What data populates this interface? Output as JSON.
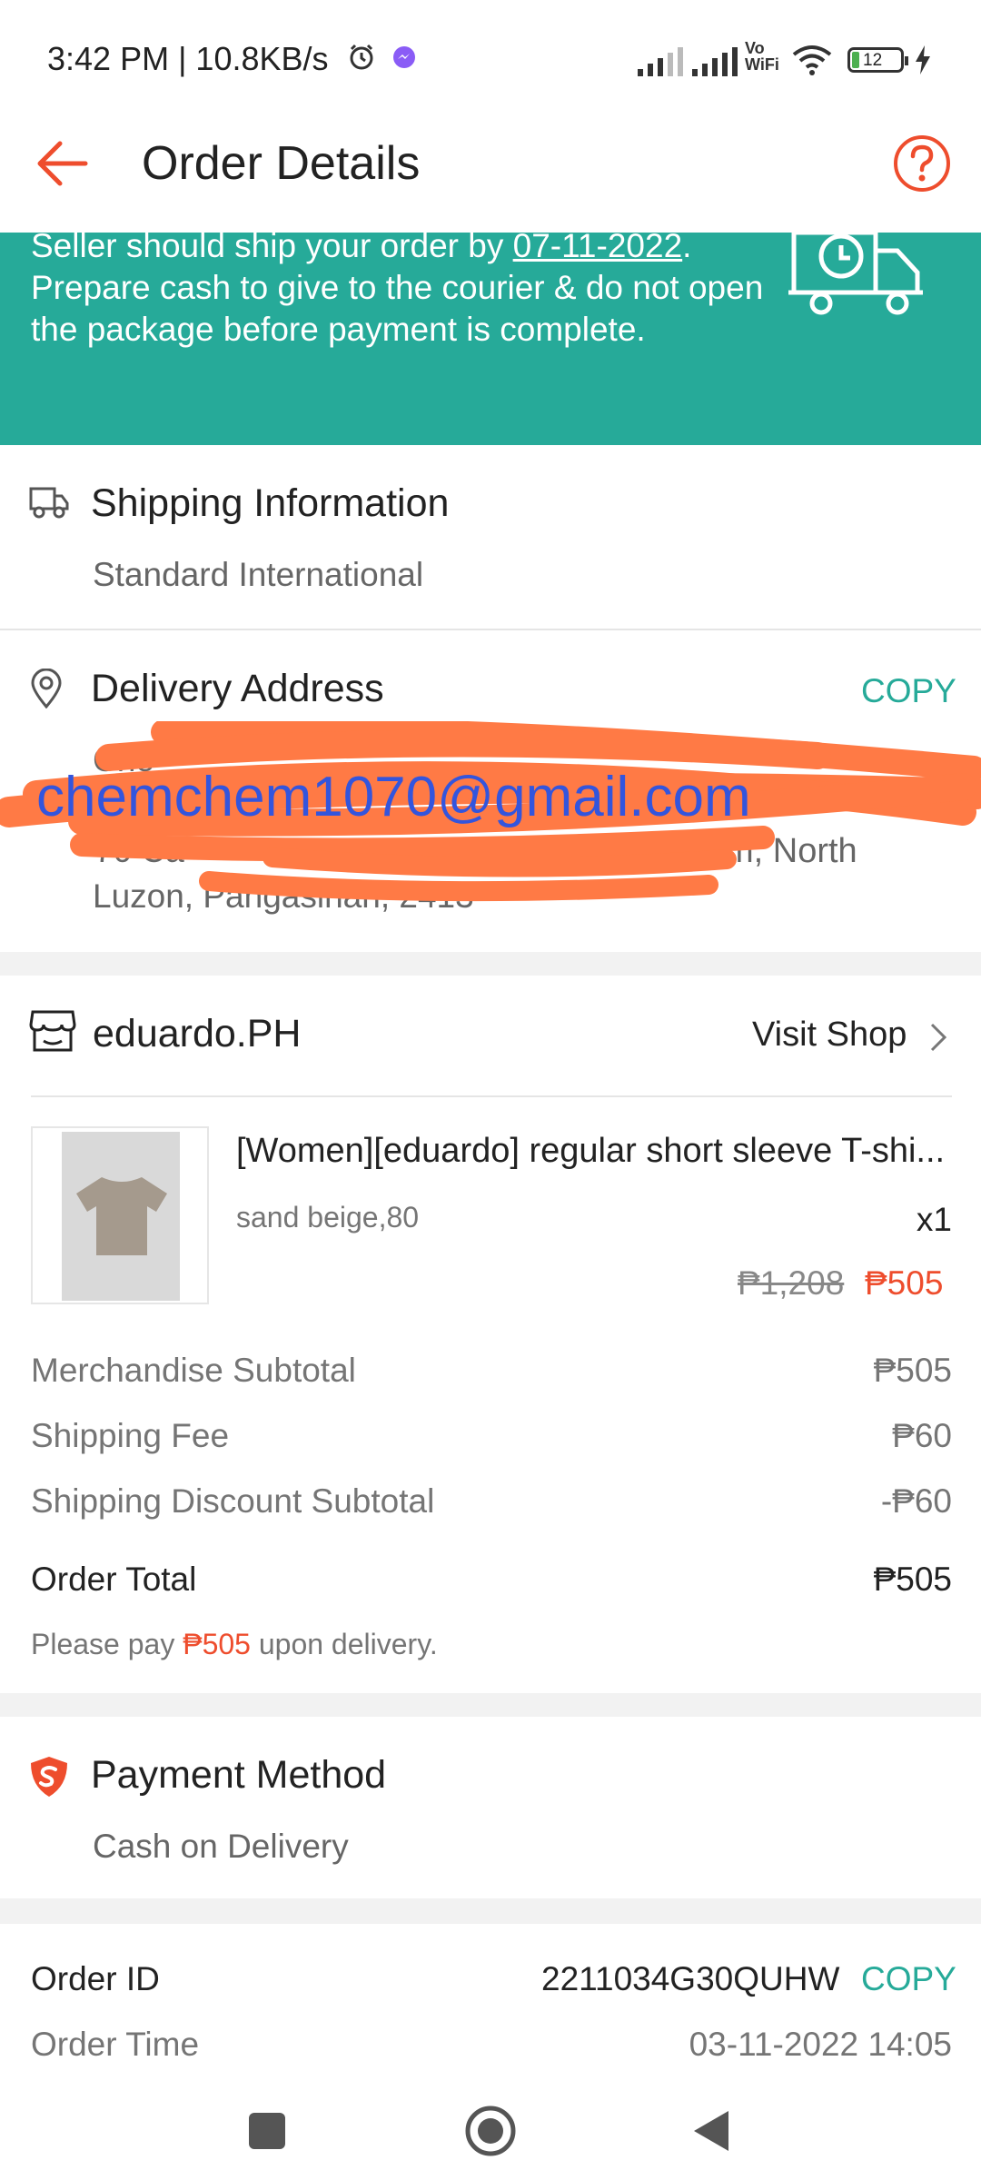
{
  "status_bar": {
    "time_speed": "3:42 PM | 10.8KB/s",
    "vo_wifi_top": "Vo",
    "vo_wifi_bottom": "WiFi",
    "battery": "12"
  },
  "header": {
    "title": "Order Details"
  },
  "banner": {
    "text_before_date": "Seller should ship your order by ",
    "ship_date": "07-11-2022",
    "text_after_date": ". Prepare cash to give to the courier & do not open the package before payment is complete."
  },
  "shipping": {
    "title": "Shipping Information",
    "method": "Standard International"
  },
  "delivery": {
    "title": "Delivery Address",
    "copy_label": "COPY",
    "name_fragment": "Che",
    "email_overlay": "chemchem1070@gmail.com",
    "address_line_start": "70 Ca",
    "address_line_end": "m, North",
    "address_line2": "Luzon, Pangasinan, 2413"
  },
  "shop": {
    "name": "eduardo.PH",
    "visit_label": "Visit Shop"
  },
  "product": {
    "name": "[Women][eduardo] regular short sleeve T-shi...",
    "variation": "sand beige,80",
    "qty": "x1",
    "original_price": "₱1,208",
    "price": "₱505"
  },
  "summary": {
    "rows": [
      {
        "label": "Merchandise Subtotal",
        "value": "₱505"
      },
      {
        "label": "Shipping Fee",
        "value": "₱60"
      },
      {
        "label": "Shipping Discount Subtotal",
        "value": "-₱60"
      }
    ],
    "total_label": "Order Total",
    "total_value": "₱505",
    "pay_note_before": "Please pay ",
    "pay_note_amount": "₱505",
    "pay_note_after": " upon delivery."
  },
  "payment": {
    "title": "Payment Method",
    "method": "Cash on Delivery"
  },
  "order": {
    "id_label": "Order ID",
    "id_value": "2211034G30QUHW",
    "copy_label": "COPY",
    "time_label": "Order Time",
    "time_value": "03-11-2022 14:05"
  },
  "colors": {
    "accent_orange": "#ee4d2d",
    "teal": "#26aa99",
    "redaction": "#ff7a45",
    "email_blue": "#3355dd"
  },
  "icons": [
    "back-arrow-icon",
    "help-icon",
    "truck-clock-icon",
    "truck-icon",
    "location-pin-icon",
    "store-icon",
    "chevron-right-icon",
    "shield-payment-icon",
    "nav-square-icon",
    "nav-home-icon",
    "nav-back-icon"
  ]
}
